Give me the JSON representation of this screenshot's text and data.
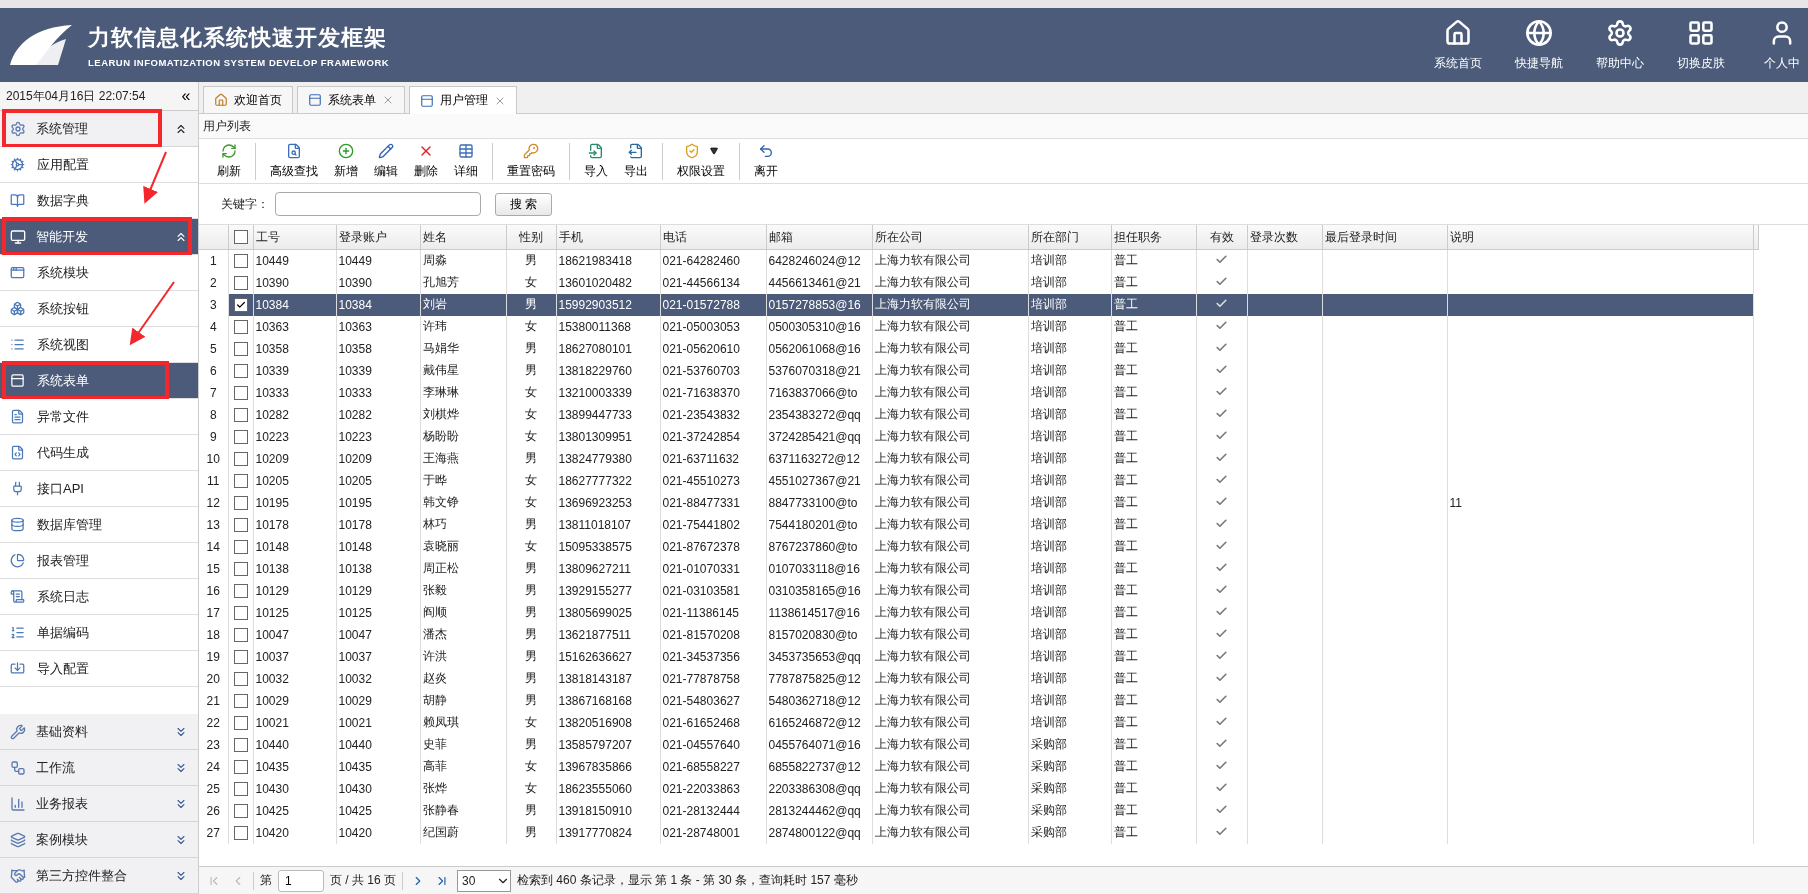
{
  "header": {
    "title": "力软信息化系统快速开发框架",
    "subtitle": "LEARUN INFOMATIZATION SYSTEM DEVELOP FRAMEWORK",
    "nav": [
      {
        "label": "系统首页"
      },
      {
        "label": "快捷导航"
      },
      {
        "label": "帮助中心"
      },
      {
        "label": "切换皮肤"
      },
      {
        "label": "个人中"
      }
    ]
  },
  "sidebar": {
    "datetime": "2015年04月16日 22:07:54",
    "collapse": "«",
    "groups": [
      {
        "label": "系统管理",
        "expanded": true,
        "selected": false,
        "annotated": true,
        "items": [
          {
            "label": "应用配置",
            "selected": false,
            "annotated": false
          },
          {
            "label": "数据字典",
            "selected": false,
            "annotated": false
          }
        ]
      },
      {
        "label": "智能开发",
        "expanded": true,
        "selected": true,
        "annotated": true,
        "items": [
          {
            "label": "系统模块",
            "selected": false,
            "annotated": false
          },
          {
            "label": "系统按钮",
            "selected": false,
            "annotated": false
          },
          {
            "label": "系统视图",
            "selected": false,
            "annotated": false
          },
          {
            "label": "系统表单",
            "selected": true,
            "annotated": true
          },
          {
            "label": "异常文件",
            "selected": false,
            "annotated": false
          },
          {
            "label": "代码生成",
            "selected": false,
            "annotated": false
          },
          {
            "label": "接口API",
            "selected": false,
            "annotated": false
          },
          {
            "label": "数据库管理",
            "selected": false,
            "annotated": false
          },
          {
            "label": "报表管理",
            "selected": false,
            "annotated": false
          },
          {
            "label": "系统日志",
            "selected": false,
            "annotated": false
          },
          {
            "label": "单据编码",
            "selected": false,
            "annotated": false
          },
          {
            "label": "导入配置",
            "selected": false,
            "annotated": false
          }
        ]
      },
      {
        "label": "基础资料",
        "expanded": false,
        "selected": false,
        "annotated": false
      },
      {
        "label": "工作流",
        "expanded": false,
        "selected": false,
        "annotated": false
      },
      {
        "label": "业务报表",
        "expanded": false,
        "selected": false,
        "annotated": false
      },
      {
        "label": "案例模块",
        "expanded": false,
        "selected": false,
        "annotated": false
      },
      {
        "label": "第三方控件整合",
        "expanded": false,
        "selected": false,
        "annotated": false
      }
    ]
  },
  "tabs": [
    {
      "label": "欢迎首页",
      "selected": false,
      "closable": false
    },
    {
      "label": "系统表单",
      "selected": false,
      "closable": true
    },
    {
      "label": "用户管理",
      "selected": true,
      "closable": true
    }
  ],
  "panel_title": "用户列表",
  "toolbar": [
    [
      {
        "label": "刷新",
        "dropdown": false
      }
    ],
    [
      {
        "label": "高级查找",
        "dropdown": false
      },
      {
        "label": "新增",
        "dropdown": false
      },
      {
        "label": "编辑",
        "dropdown": false
      },
      {
        "label": "删除",
        "dropdown": false
      },
      {
        "label": "详细",
        "dropdown": false
      }
    ],
    [
      {
        "label": "重置密码",
        "dropdown": false
      }
    ],
    [
      {
        "label": "导入",
        "dropdown": false
      },
      {
        "label": "导出",
        "dropdown": false
      }
    ],
    [
      {
        "label": "权限设置",
        "dropdown": true
      }
    ],
    [
      {
        "label": "离开",
        "dropdown": false
      }
    ]
  ],
  "search": {
    "label": "关键字：",
    "button": "搜 索"
  },
  "table": {
    "select_all": {
      "checked": false
    },
    "columns": [
      {
        "label": "工号"
      },
      {
        "label": "登录账户"
      },
      {
        "label": "姓名"
      },
      {
        "label": "性别"
      },
      {
        "label": "手机"
      },
      {
        "label": "电话"
      },
      {
        "label": "邮箱"
      },
      {
        "label": "所在公司"
      },
      {
        "label": "所在部门"
      },
      {
        "label": "担任职务"
      },
      {
        "label": "有效"
      },
      {
        "label": "登录次数"
      },
      {
        "label": "最后登录时间"
      },
      {
        "label": "说明"
      }
    ],
    "rows": [
      {
        "n": "1",
        "id": "10449",
        "account": "10449",
        "name": "周淼",
        "gender": "男",
        "mobile": "18621983418",
        "phone": "021-64282460",
        "email": "6428246024@12",
        "company": "上海力软有限公司",
        "dept": "培训部",
        "post": "普工",
        "valid": true,
        "checked": false,
        "selected": false
      },
      {
        "n": "2",
        "id": "10390",
        "account": "10390",
        "name": "孔旭芳",
        "gender": "女",
        "mobile": "13601020482",
        "phone": "021-44566134",
        "email": "4456613461@21",
        "company": "上海力软有限公司",
        "dept": "培训部",
        "post": "普工",
        "valid": true,
        "checked": false,
        "selected": false
      },
      {
        "n": "3",
        "id": "10384",
        "account": "10384",
        "name": "刘岩",
        "gender": "男",
        "mobile": "15992903512",
        "phone": "021-01572788",
        "email": "0157278853@16",
        "company": "上海力软有限公司",
        "dept": "培训部",
        "post": "普工",
        "valid": true,
        "checked": true,
        "selected": true
      },
      {
        "n": "4",
        "id": "10363",
        "account": "10363",
        "name": "许玮",
        "gender": "女",
        "mobile": "15380011368",
        "phone": "021-05003053",
        "email": "0500305310@16",
        "company": "上海力软有限公司",
        "dept": "培训部",
        "post": "普工",
        "valid": true,
        "checked": false,
        "selected": false
      },
      {
        "n": "5",
        "id": "10358",
        "account": "10358",
        "name": "马娟华",
        "gender": "男",
        "mobile": "18627080101",
        "phone": "021-05620610",
        "email": "0562061068@16",
        "company": "上海力软有限公司",
        "dept": "培训部",
        "post": "普工",
        "valid": true,
        "checked": false,
        "selected": false
      },
      {
        "n": "6",
        "id": "10339",
        "account": "10339",
        "name": "戴伟星",
        "gender": "男",
        "mobile": "13818229760",
        "phone": "021-53760703",
        "email": "5376070318@21",
        "company": "上海力软有限公司",
        "dept": "培训部",
        "post": "普工",
        "valid": true,
        "checked": false,
        "selected": false
      },
      {
        "n": "7",
        "id": "10333",
        "account": "10333",
        "name": "李琳琳",
        "gender": "女",
        "mobile": "13210003339",
        "phone": "021-71638370",
        "email": "7163837066@to",
        "company": "上海力软有限公司",
        "dept": "培训部",
        "post": "普工",
        "valid": true,
        "checked": false,
        "selected": false
      },
      {
        "n": "8",
        "id": "10282",
        "account": "10282",
        "name": "刘棋烨",
        "gender": "女",
        "mobile": "13899447733",
        "phone": "021-23543832",
        "email": "2354383272@qq",
        "company": "上海力软有限公司",
        "dept": "培训部",
        "post": "普工",
        "valid": true,
        "checked": false,
        "selected": false
      },
      {
        "n": "9",
        "id": "10223",
        "account": "10223",
        "name": "杨盼盼",
        "gender": "女",
        "mobile": "13801309951",
        "phone": "021-37242854",
        "email": "3724285421@qq",
        "company": "上海力软有限公司",
        "dept": "培训部",
        "post": "普工",
        "valid": true,
        "checked": false,
        "selected": false
      },
      {
        "n": "10",
        "id": "10209",
        "account": "10209",
        "name": "王海燕",
        "gender": "男",
        "mobile": "13824779380",
        "phone": "021-63711632",
        "email": "6371163272@12",
        "company": "上海力软有限公司",
        "dept": "培训部",
        "post": "普工",
        "valid": true,
        "checked": false,
        "selected": false
      },
      {
        "n": "11",
        "id": "10205",
        "account": "10205",
        "name": "于晔",
        "gender": "女",
        "mobile": "18627777322",
        "phone": "021-45510273",
        "email": "4551027367@21",
        "company": "上海力软有限公司",
        "dept": "培训部",
        "post": "普工",
        "valid": true,
        "checked": false,
        "selected": false
      },
      {
        "n": "12",
        "id": "10195",
        "account": "10195",
        "name": "韩文铮",
        "gender": "女",
        "mobile": "13696923253",
        "phone": "021-88477331",
        "email": "8847733100@to",
        "company": "上海力软有限公司",
        "dept": "培训部",
        "post": "普工",
        "valid": true,
        "checked": false,
        "selected": false,
        "note": "11"
      },
      {
        "n": "13",
        "id": "10178",
        "account": "10178",
        "name": "林巧",
        "gender": "男",
        "mobile": "13811018107",
        "phone": "021-75441802",
        "email": "7544180201@to",
        "company": "上海力软有限公司",
        "dept": "培训部",
        "post": "普工",
        "valid": true,
        "checked": false,
        "selected": false
      },
      {
        "n": "14",
        "id": "10148",
        "account": "10148",
        "name": "袁晓丽",
        "gender": "女",
        "mobile": "15095338575",
        "phone": "021-87672378",
        "email": "8767237860@to",
        "company": "上海力软有限公司",
        "dept": "培训部",
        "post": "普工",
        "valid": true,
        "checked": false,
        "selected": false
      },
      {
        "n": "15",
        "id": "10138",
        "account": "10138",
        "name": "周正松",
        "gender": "男",
        "mobile": "13809627211",
        "phone": "021-01070331",
        "email": "0107033118@16",
        "company": "上海力软有限公司",
        "dept": "培训部",
        "post": "普工",
        "valid": true,
        "checked": false,
        "selected": false
      },
      {
        "n": "16",
        "id": "10129",
        "account": "10129",
        "name": "张毅",
        "gender": "男",
        "mobile": "13929155277",
        "phone": "021-03103581",
        "email": "0310358165@16",
        "company": "上海力软有限公司",
        "dept": "培训部",
        "post": "普工",
        "valid": true,
        "checked": false,
        "selected": false
      },
      {
        "n": "17",
        "id": "10125",
        "account": "10125",
        "name": "阎顺",
        "gender": "男",
        "mobile": "13805699025",
        "phone": "021-11386145",
        "email": "1138614517@16",
        "company": "上海力软有限公司",
        "dept": "培训部",
        "post": "普工",
        "valid": true,
        "checked": false,
        "selected": false
      },
      {
        "n": "18",
        "id": "10047",
        "account": "10047",
        "name": "潘杰",
        "gender": "男",
        "mobile": "13621877511",
        "phone": "021-81570208",
        "email": "8157020830@to",
        "company": "上海力软有限公司",
        "dept": "培训部",
        "post": "普工",
        "valid": true,
        "checked": false,
        "selected": false
      },
      {
        "n": "19",
        "id": "10037",
        "account": "10037",
        "name": "许洪",
        "gender": "男",
        "mobile": "15162636627",
        "phone": "021-34537356",
        "email": "3453735653@qq",
        "company": "上海力软有限公司",
        "dept": "培训部",
        "post": "普工",
        "valid": true,
        "checked": false,
        "selected": false
      },
      {
        "n": "20",
        "id": "10032",
        "account": "10032",
        "name": "赵炎",
        "gender": "男",
        "mobile": "13818143187",
        "phone": "021-77878758",
        "email": "7787875825@12",
        "company": "上海力软有限公司",
        "dept": "培训部",
        "post": "普工",
        "valid": true,
        "checked": false,
        "selected": false
      },
      {
        "n": "21",
        "id": "10029",
        "account": "10029",
        "name": "胡静",
        "gender": "男",
        "mobile": "13867168168",
        "phone": "021-54803627",
        "email": "5480362718@12",
        "company": "上海力软有限公司",
        "dept": "培训部",
        "post": "普工",
        "valid": true,
        "checked": false,
        "selected": false
      },
      {
        "n": "22",
        "id": "10021",
        "account": "10021",
        "name": "赖凤琪",
        "gender": "女",
        "mobile": "13820516908",
        "phone": "021-61652468",
        "email": "6165246872@12",
        "company": "上海力软有限公司",
        "dept": "培训部",
        "post": "普工",
        "valid": true,
        "checked": false,
        "selected": false
      },
      {
        "n": "23",
        "id": "10440",
        "account": "10440",
        "name": "史菲",
        "gender": "男",
        "mobile": "13585797207",
        "phone": "021-04557640",
        "email": "0455764071@16",
        "company": "上海力软有限公司",
        "dept": "采购部",
        "post": "普工",
        "valid": true,
        "checked": false,
        "selected": false
      },
      {
        "n": "24",
        "id": "10435",
        "account": "10435",
        "name": "高菲",
        "gender": "女",
        "mobile": "13967835866",
        "phone": "021-68558227",
        "email": "6855822737@12",
        "company": "上海力软有限公司",
        "dept": "采购部",
        "post": "普工",
        "valid": true,
        "checked": false,
        "selected": false
      },
      {
        "n": "25",
        "id": "10430",
        "account": "10430",
        "name": "张烨",
        "gender": "女",
        "mobile": "18623555060",
        "phone": "021-22033863",
        "email": "2203386308@qq",
        "company": "上海力软有限公司",
        "dept": "采购部",
        "post": "普工",
        "valid": true,
        "checked": false,
        "selected": false
      },
      {
        "n": "26",
        "id": "10425",
        "account": "10425",
        "name": "张静春",
        "gender": "男",
        "mobile": "13918150910",
        "phone": "021-28132444",
        "email": "2813244462@qq",
        "company": "上海力软有限公司",
        "dept": "采购部",
        "post": "普工",
        "valid": true,
        "checked": false,
        "selected": false
      },
      {
        "n": "27",
        "id": "10420",
        "account": "10420",
        "name": "纪国蔚",
        "gender": "男",
        "mobile": "13917770824",
        "phone": "021-28748001",
        "email": "2874800122@qq",
        "company": "上海力软有限公司",
        "dept": "采购部",
        "post": "普工",
        "valid": true,
        "checked": false,
        "selected": false
      }
    ]
  },
  "pager": {
    "page_prefix": "第",
    "page": "1",
    "page_suffix": "页 / 共 16 页",
    "page_size": "30",
    "info": "检索到 460 条记录，显示 第 1 条 - 第 30 条，查询耗时 157 毫秒"
  }
}
